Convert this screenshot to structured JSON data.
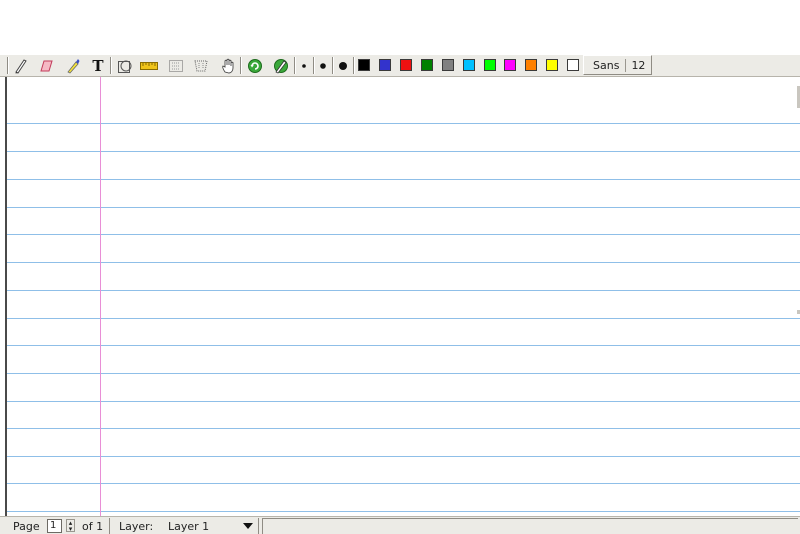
{
  "toolbar": {
    "tools": [
      "pencil",
      "eraser",
      "highlighter",
      "text",
      "shape-recognizer",
      "ruler",
      "select-rectangle",
      "select-region",
      "hand",
      "default-pen",
      "default-tool",
      "thin",
      "medium",
      "thick"
    ],
    "text_tool_glyph": "T",
    "colors": [
      "#000000",
      "#3333cc",
      "#ee1111",
      "#008000",
      "#808080",
      "#00c0ff",
      "#00ff00",
      "#ff00ff",
      "#ff8000",
      "#ffff00",
      "#ffffff"
    ],
    "font_name": "Sans",
    "font_size": "12"
  },
  "page": {
    "ruling": "lined",
    "line_color": "#8fbfe8",
    "margin_color": "#e88ed6",
    "background": "#ffffff"
  },
  "statusbar": {
    "page_label": "Page",
    "page_value": "1",
    "of_label": "of 1",
    "layer_label": "Layer:",
    "layer_value": "Layer 1"
  }
}
